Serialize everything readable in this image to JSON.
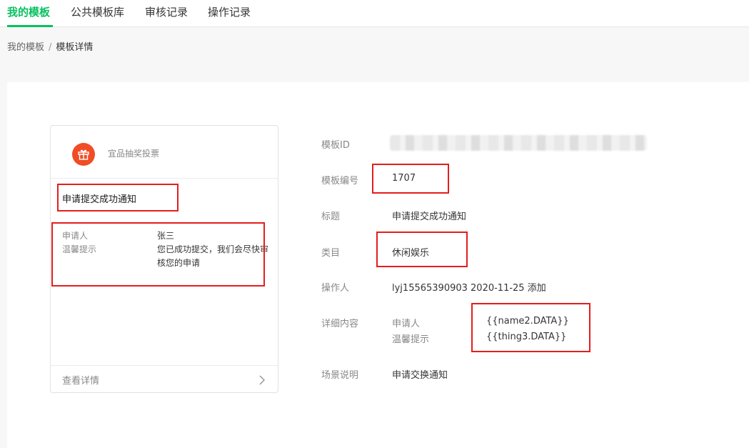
{
  "tabs": [
    {
      "label": "我的模板"
    },
    {
      "label": "公共模板库"
    },
    {
      "label": "审核记录"
    },
    {
      "label": "操作记录"
    }
  ],
  "breadcrumb": {
    "parent": "我的模板",
    "separator": "/",
    "current": "模板详情"
  },
  "preview": {
    "app_name": "宜品抽奖投票",
    "title": "申请提交成功通知",
    "fields": [
      {
        "key": "申请人",
        "value": "张三"
      },
      {
        "key": "温馨提示",
        "value": "您已成功提交，我们会尽快审核您的申请"
      }
    ],
    "footer_link": "查看详情",
    "icon": "gift-icon",
    "icon_color": "#f04d26"
  },
  "details": {
    "template_id_label": "模板ID",
    "template_no_label": "模板编号",
    "template_no": "1707",
    "title_label": "标题",
    "title": "申请提交成功通知",
    "category_label": "类目",
    "category": "休闲娱乐",
    "operator_label": "操作人",
    "operator": "lyj15565390903 2020-11-25 添加",
    "content_label": "详细内容",
    "content": [
      {
        "key": "申请人",
        "value": "{{name2.DATA}}"
      },
      {
        "key": "温馨提示",
        "value": "{{thing3.DATA}}"
      }
    ],
    "scene_label": "场景说明",
    "scene": "申请交换通知"
  },
  "colors": {
    "accent": "#07c160",
    "annotation": "#e41d1d"
  }
}
